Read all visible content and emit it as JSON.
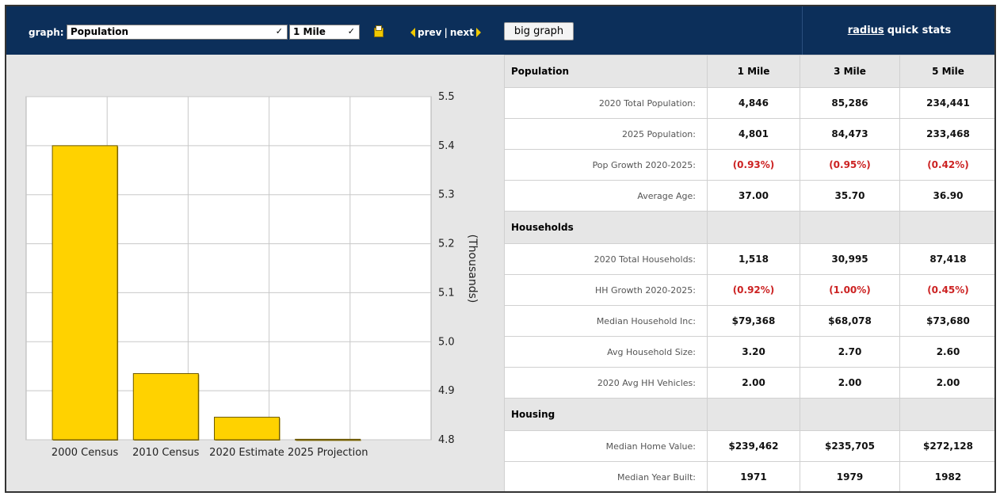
{
  "toolbar": {
    "graph_label": "graph:",
    "graph_select": "Population",
    "radius_select": "1 Mile",
    "prev_label": "prev",
    "separator": "|",
    "next_label": "next",
    "big_graph_label": "big graph"
  },
  "stats_header": {
    "link_text": "radius",
    "rest_text": "quick stats"
  },
  "chart_data": {
    "type": "bar",
    "categories": [
      "2000 Census",
      "2010 Census",
      "2020 Estimate",
      "2025 Projection"
    ],
    "values": [
      5.4,
      4.935,
      4.846,
      4.801
    ],
    "ylabel": "(Thousands)",
    "ylim": [
      4.8,
      5.5
    ],
    "yticks": [
      "5.5",
      "5.4",
      "5.3",
      "5.2",
      "5.1",
      "5.0",
      "4.9",
      "4.8"
    ],
    "ytick_values": [
      5.5,
      5.4,
      5.3,
      5.2,
      5.1,
      5.0,
      4.9,
      4.8
    ],
    "grid": true,
    "y_axis_side": "right",
    "bar_color": "#ffd200"
  },
  "table": {
    "columns": [
      "1 Mile",
      "3 Mile",
      "5 Mile"
    ],
    "sections": [
      {
        "name": "Population",
        "rows": [
          {
            "label": "2020 Total Population:",
            "values": [
              "4,846",
              "85,286",
              "234,441"
            ],
            "negative": false
          },
          {
            "label": "2025 Population:",
            "values": [
              "4,801",
              "84,473",
              "233,468"
            ],
            "negative": false
          },
          {
            "label": "Pop Growth 2020-2025:",
            "values": [
              "(0.93%)",
              "(0.95%)",
              "(0.42%)"
            ],
            "negative": true
          },
          {
            "label": "Average Age:",
            "values": [
              "37.00",
              "35.70",
              "36.90"
            ],
            "negative": false
          }
        ]
      },
      {
        "name": "Households",
        "rows": [
          {
            "label": "2020 Total Households:",
            "values": [
              "1,518",
              "30,995",
              "87,418"
            ],
            "negative": false
          },
          {
            "label": "HH Growth 2020-2025:",
            "values": [
              "(0.92%)",
              "(1.00%)",
              "(0.45%)"
            ],
            "negative": true
          },
          {
            "label": "Median Household Inc:",
            "values": [
              "$79,368",
              "$68,078",
              "$73,680"
            ],
            "negative": false
          },
          {
            "label": "Avg Household Size:",
            "values": [
              "3.20",
              "2.70",
              "2.60"
            ],
            "negative": false
          },
          {
            "label": "2020 Avg HH Vehicles:",
            "values": [
              "2.00",
              "2.00",
              "2.00"
            ],
            "negative": false
          }
        ]
      },
      {
        "name": "Housing",
        "rows": [
          {
            "label": "Median Home Value:",
            "values": [
              "$239,462",
              "$235,705",
              "$272,128"
            ],
            "negative": false
          },
          {
            "label": "Median Year Built:",
            "values": [
              "1971",
              "1979",
              "1982"
            ],
            "negative": false
          }
        ]
      }
    ]
  }
}
